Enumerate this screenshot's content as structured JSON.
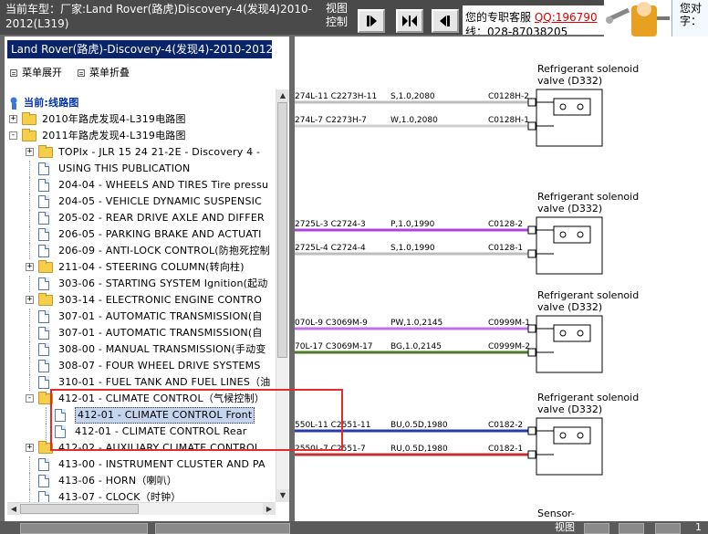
{
  "topbar": {
    "title": "当前车型：厂家:Land Rover(路虎)Discovery-4(发现4)2010-2012(L319)",
    "view_label": "视图控制",
    "service": {
      "line1_prefix": "您的专职客服",
      "qq": "QQ:196790",
      "line2": "线：028-87038205"
    },
    "help_text": "您对字："
  },
  "left_panel": {
    "model": "Land Rover(路虎)-Discovery-4(发现4)-2010-2012(L",
    "expand_all": "菜单展开",
    "collapse_all": "菜单折叠",
    "current_label": "当前:线路图",
    "tree": [
      {
        "label": "2010年路虎发现4-L319电路图",
        "level": 0,
        "type": "folder",
        "expander": "+"
      },
      {
        "label": "2011年路虎发现4-L319电路图",
        "level": 0,
        "type": "folder",
        "expander": "−"
      },
      {
        "label": "TOPIx - JLR 15 24 21-2E - Discovery 4 -",
        "level": 1,
        "type": "folder",
        "expander": "+"
      },
      {
        "label": "USING THIS PUBLICATION",
        "level": 1,
        "type": "doc"
      },
      {
        "label": "204-04 - WHEELS AND TIRES Tire pressu",
        "level": 1,
        "type": "doc"
      },
      {
        "label": "204-05 - VEHICLE DYNAMIC SUSPENSIC",
        "level": 1,
        "type": "doc"
      },
      {
        "label": "205-02 - REAR DRIVE AXLE AND DIFFER",
        "level": 1,
        "type": "doc"
      },
      {
        "label": "206-05 - PARKING BRAKE AND ACTUATI",
        "level": 1,
        "type": "doc"
      },
      {
        "label": "206-09 - ANTI-LOCK CONTROL(防抱死控制",
        "level": 1,
        "type": "doc"
      },
      {
        "label": "211-04 - STEERING COLUMN(转向柱)",
        "level": 1,
        "type": "folder",
        "expander": "+"
      },
      {
        "label": "303-06 - STARTING SYSTEM Ignition(起动",
        "level": 1,
        "type": "doc"
      },
      {
        "label": "303-14 - ELECTRONIC ENGINE CONTRO",
        "level": 1,
        "type": "folder",
        "expander": "+"
      },
      {
        "label": "307-01 - AUTOMATIC TRANSMISSION(自",
        "level": 1,
        "type": "doc"
      },
      {
        "label": "307-01 - AUTOMATIC TRANSMISSION(自",
        "level": 1,
        "type": "doc"
      },
      {
        "label": "308-00 - MANUAL TRANSMISSION(手动变",
        "level": 1,
        "type": "doc"
      },
      {
        "label": "308-07 - FOUR WHEEL DRIVE SYSTEMS",
        "level": 1,
        "type": "doc"
      },
      {
        "label": "310-01 - FUEL TANK AND FUEL LINES（油",
        "level": 1,
        "type": "doc"
      },
      {
        "label": "412-01 - CLIMATE CONTROL（气候控制）",
        "level": 1,
        "type": "folder",
        "expander": "−"
      },
      {
        "label": "412-01 - CLIMATE CONTROL Front",
        "level": 2,
        "type": "doc",
        "selected": true
      },
      {
        "label": "412-01 - CLIMATE CONTROL Rear",
        "level": 2,
        "type": "doc"
      },
      {
        "label": "412-02 - AUXILIARY CLIMATE CONTROL",
        "level": 1,
        "type": "folder",
        "expander": "+"
      },
      {
        "label": "413-00 - INSTRUMENT CLUSTER AND PA",
        "level": 1,
        "type": "doc"
      },
      {
        "label": "413-06 - HORN（喇叭）",
        "level": 1,
        "type": "doc"
      },
      {
        "label": "413-07 - CLOCK（时钟）",
        "level": 1,
        "type": "doc"
      }
    ]
  },
  "diagram": {
    "components": [
      {
        "name": "Refrigerant solenoid",
        "name2": "valve (D332)"
      },
      {
        "name": "Refrigerant solenoid",
        "name2": "valve (D332)"
      },
      {
        "name": "Refrigerant solenoid",
        "name2": "valve (D332)"
      },
      {
        "name": "Refrigerant solenoid",
        "name2": "valve (D332)"
      },
      {
        "name": "Sensor-",
        "name2": ""
      }
    ],
    "wires": [
      {
        "left": "274L-11 C2273H-11",
        "spec": "S,1.0,2080",
        "conn": "C0128H-2",
        "color": "#bdbdbd"
      },
      {
        "left": "274L-7 C2273H-7",
        "spec": "W,1.0,2080",
        "conn": "C0128H-1",
        "color": "#cfcfcf"
      },
      {
        "left": "2725L-3 C2724-3",
        "spec": "P,1.0,1990",
        "conn": "C0128-2",
        "color": "#b040e0"
      },
      {
        "left": "2725L-4 C2724-4",
        "spec": "S,1.0,1990",
        "conn": "C0128-1",
        "color": "#bdbdbd"
      },
      {
        "left": "070L-9 C3069M-9",
        "spec": "PW,1.0,2145",
        "conn": "C0999M-1",
        "color": "#c070e8"
      },
      {
        "left": "70L-17 C3069M-17",
        "spec": "BG,1.0,2145",
        "conn": "C0999M-2",
        "color": "#4f7a2a"
      },
      {
        "left": "550L-11 C2551-11",
        "spec": "BU,0.5D,1980",
        "conn": "C0182-2",
        "color": "#2838b0"
      },
      {
        "left": "2550L-7 C2551-7",
        "spec": "RU,0.5D,1980",
        "conn": "C0182-1",
        "color": "#c03030"
      }
    ]
  },
  "bottombar": {
    "view_label": "视图",
    "page": "1"
  },
  "colors": {
    "selection_box": "#e52a2a",
    "model_bar": "#0a246a",
    "qq_link": "#e00000"
  }
}
